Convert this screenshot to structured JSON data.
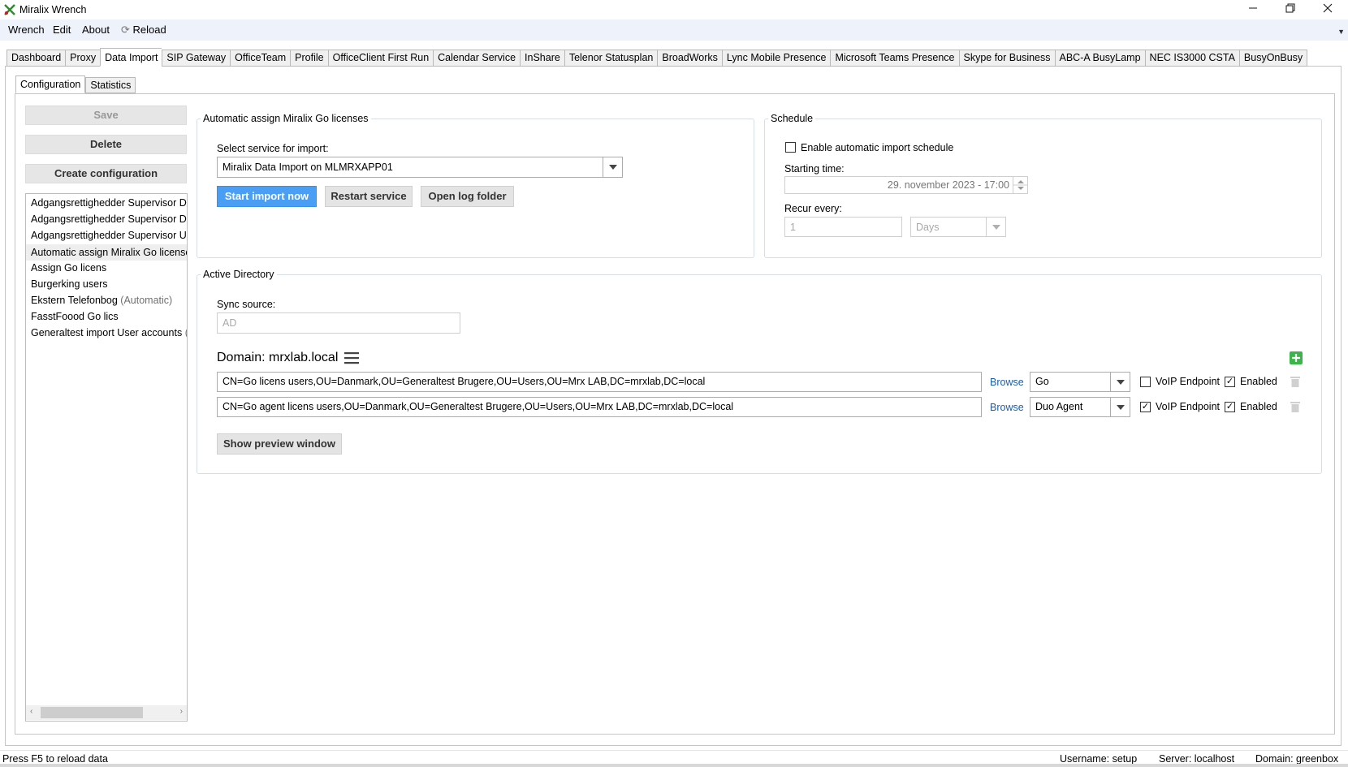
{
  "window": {
    "title": "Miralix Wrench"
  },
  "menu": {
    "items": [
      "Wrench",
      "Edit",
      "About"
    ],
    "reload": "Reload"
  },
  "tabs": [
    "Dashboard",
    "Proxy",
    "Data Import",
    "SIP Gateway",
    "OfficeTeam",
    "Profile",
    "OfficeClient First Run",
    "Calendar Service",
    "InShare",
    "Telenor Statusplan",
    "BroadWorks",
    "Lync Mobile Presence",
    "Microsoft Teams Presence",
    "Skype for Business",
    "ABC-A BusyLamp",
    "NEC IS3000 CSTA",
    "BusyOnBusy"
  ],
  "active_tab": "Data Import",
  "subtabs": [
    "Configuration",
    "Statistics"
  ],
  "sidebar": {
    "save": "Save",
    "delete": "Delete",
    "create": "Create configuration",
    "items": [
      {
        "label": "Adgangsrettighedder Supervisor DE",
        "suffix": ""
      },
      {
        "label": "Adgangsrettighedder Supervisor DK",
        "suffix": ""
      },
      {
        "label": "Adgangsrettighedder Supervisor UK",
        "suffix": ""
      },
      {
        "label": "Automatic assign Miralix Go licenses",
        "suffix": ""
      },
      {
        "label": "Assign Go licens",
        "suffix": ""
      },
      {
        "label": "Burgerking users",
        "suffix": ""
      },
      {
        "label": "Ekstern Telefonbog",
        "suffix": "(Automatic)"
      },
      {
        "label": "FasstFoood Go lics",
        "suffix": ""
      },
      {
        "label": "Generaltest import User accounts",
        "suffix": "(A"
      }
    ]
  },
  "config": {
    "title": "Automatic assign Miralix Go licenses",
    "service_label": "Select service for import:",
    "service_value": "Miralix Data Import on MLMRXAPP01",
    "start_import": "Start import now",
    "restart_service": "Restart service",
    "open_log": "Open log folder"
  },
  "schedule": {
    "title": "Schedule",
    "enable_label": "Enable automatic import schedule",
    "starting_label": "Starting time:",
    "starting_value": "29. november 2023 - 17:00",
    "recur_label": "Recur every:",
    "recur_value": "1",
    "recur_unit": "Days"
  },
  "ad": {
    "title": "Active Directory",
    "sync_label": "Sync source:",
    "sync_value": "AD",
    "domain_title": "Domain: mrxlab.local",
    "rows": [
      {
        "dn": "CN=Go licens users,OU=Danmark,OU=Generaltest Brugere,OU=Users,OU=Mrx LAB,DC=mrxlab,DC=local",
        "browse": "Browse",
        "type": "Go",
        "voip_label": "VoIP Endpoint",
        "voip": "",
        "enabled_label": "Enabled",
        "enabled": "✓"
      },
      {
        "dn": "CN=Go agent licens users,OU=Danmark,OU=Generaltest Brugere,OU=Users,OU=Mrx LAB,DC=mrxlab,DC=local",
        "browse": "Browse",
        "type": "Duo Agent",
        "voip_label": "VoIP Endpoint",
        "voip": "✓",
        "enabled_label": "Enabled",
        "enabled": "✓"
      }
    ],
    "preview": "Show preview window"
  },
  "status": {
    "hint": "Press F5 to reload data",
    "username": "Username: setup",
    "server": "Server: localhost",
    "domain": "Domain: greenbox"
  },
  "colors": {
    "primary_button": "#4a9ff5",
    "link": "#1a5ea8",
    "add_icon": "#3bb54a"
  }
}
